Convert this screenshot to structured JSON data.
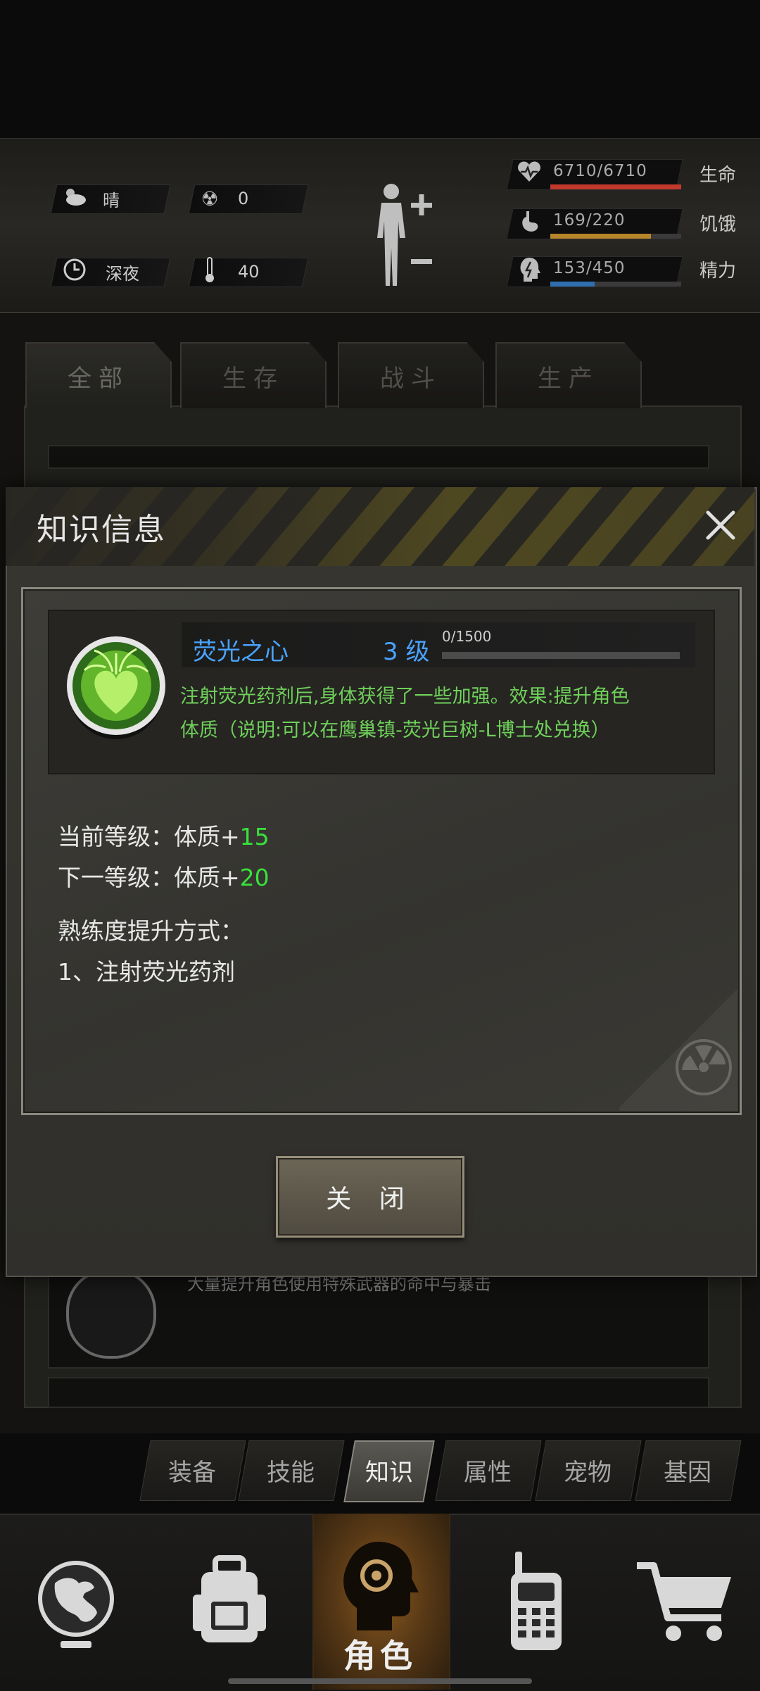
{
  "status": {
    "weather": "晴",
    "radiation": "0",
    "time_of_day": "深夜",
    "temperature": "40",
    "life": {
      "value": "6710/6710",
      "label": "生命",
      "ratio": 1.0,
      "color": "#c0392b"
    },
    "hunger": {
      "value": "169/220",
      "label": "饥饿",
      "ratio": 0.768,
      "color": "#b8862a"
    },
    "energy": {
      "value": "153/450",
      "label": "精力",
      "ratio": 0.34,
      "color": "#2f6fb0"
    },
    "body_icon": "body-figure-plus-minus-icon"
  },
  "category_tabs": [
    {
      "label": "全部",
      "active": true
    },
    {
      "label": "生存",
      "active": false
    },
    {
      "label": "战斗",
      "active": false
    },
    {
      "label": "生产",
      "active": false
    }
  ],
  "background_list": {
    "partial_text": "大量提升角色使用特殊武器的命中与暴击"
  },
  "modal": {
    "title": "知识信息",
    "skill": {
      "name": "荧光之心",
      "level": "3 级",
      "exp": "0/1500",
      "exp_ratio": 0.0,
      "description_line1": "注射荧光药剂后,身体获得了一些加强。效果:提升角色",
      "description_line2": "体质（说明:可以在鹰巢镇-荧光巨树-L博士处兑换）"
    },
    "current_level_label": "当前等级：体质+",
    "current_level_value": "15",
    "next_level_label": "下一等级：体质+",
    "next_level_value": "20",
    "method_title": "熟练度提升方式：",
    "method_item": "1、注射荧光药剂",
    "close_button": "关 闭"
  },
  "sub_tabs": [
    {
      "label": "装备",
      "active": false
    },
    {
      "label": "技能",
      "active": false
    },
    {
      "label": "知识",
      "active": true
    },
    {
      "label": "属性",
      "active": false
    },
    {
      "label": "宠物",
      "active": false
    },
    {
      "label": "基因",
      "active": false
    }
  ],
  "bottom_nav": [
    {
      "icon": "globe-icon",
      "active": false
    },
    {
      "icon": "backpack-icon",
      "active": false
    },
    {
      "icon": "character-head-icon",
      "label": "角色",
      "active": true
    },
    {
      "icon": "walkie-talkie-icon",
      "active": false
    },
    {
      "icon": "shopping-cart-icon",
      "active": false
    }
  ]
}
